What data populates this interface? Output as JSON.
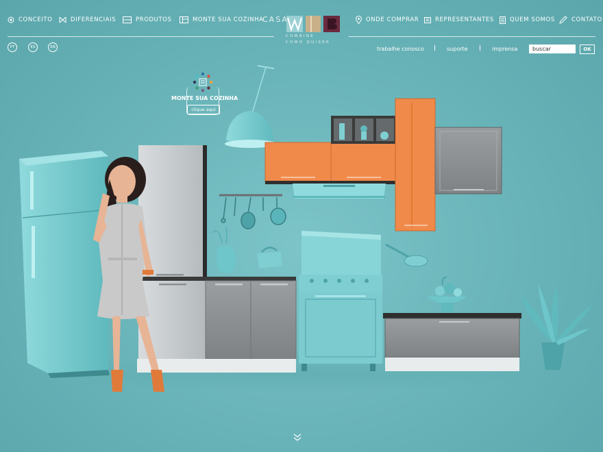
{
  "nav": {
    "left": [
      {
        "label": "CONCEITO",
        "icon": "conceito-icon"
      },
      {
        "label": "DIFERENCIAIS",
        "icon": "diferenciais-icon"
      },
      {
        "label": "PRODUTOS",
        "icon": "produtos-icon"
      },
      {
        "label": "MONTE SUA COZINHA",
        "icon": "monte-icon"
      }
    ],
    "right": [
      {
        "label": "ONDE COMPRAR",
        "icon": "map-pin-icon"
      },
      {
        "label": "REPRESENTANTES",
        "icon": "representantes-icon"
      },
      {
        "label": "QUEM SOMOS",
        "icon": "document-icon"
      },
      {
        "label": "CONTATO",
        "icon": "pencil-icon"
      }
    ]
  },
  "logo": {
    "word": "CASA",
    "tagline_line1": "COMBINE",
    "tagline_line2": "COMO QUISER"
  },
  "languages": [
    "PT",
    "ES",
    "EN"
  ],
  "sublinks": [
    "trabalhe conosco",
    "suporte",
    "imprensa"
  ],
  "search": {
    "value": "buscar",
    "button": "OK"
  },
  "promo": {
    "title": "MONTE SUA COZINHA",
    "cta": "clique aqui"
  },
  "colors": {
    "background": "#68b3b8",
    "turquoise": "#7fcfd2",
    "orange": "#f08a4b",
    "cabinet_gray": "#8e9294",
    "silver": "#c6cbcd",
    "logo_tan": "#c8b08a",
    "logo_burgundy": "#6b2a3e"
  }
}
